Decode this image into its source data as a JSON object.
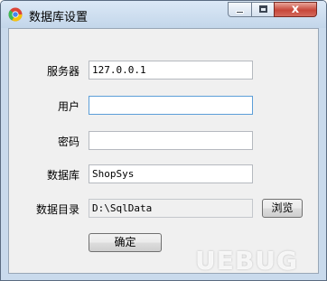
{
  "window": {
    "title": "数据库设置",
    "close_glyph": "x"
  },
  "form": {
    "server_label": "服务器",
    "server_value": "127.0.0.1",
    "user_label": "用户",
    "user_value": "",
    "password_label": "密码",
    "password_value": "",
    "database_label": "数据库",
    "database_value": "ShopSys",
    "directory_label": "数据目录",
    "directory_value": "D:\\SqlData"
  },
  "buttons": {
    "browse_label": "浏览",
    "ok_label": "确定"
  },
  "watermark": {
    "text": "UEBUG"
  },
  "icons": {
    "app": "chrome-logo-icon",
    "minimize": "minimize-icon",
    "maximize": "maximize-icon",
    "close": "close-icon"
  },
  "colors": {
    "title_bar": "#c9daec",
    "client_bg": "#f0f0f0",
    "close_button": "#c7473a",
    "focus_border": "#5c9ed8"
  }
}
